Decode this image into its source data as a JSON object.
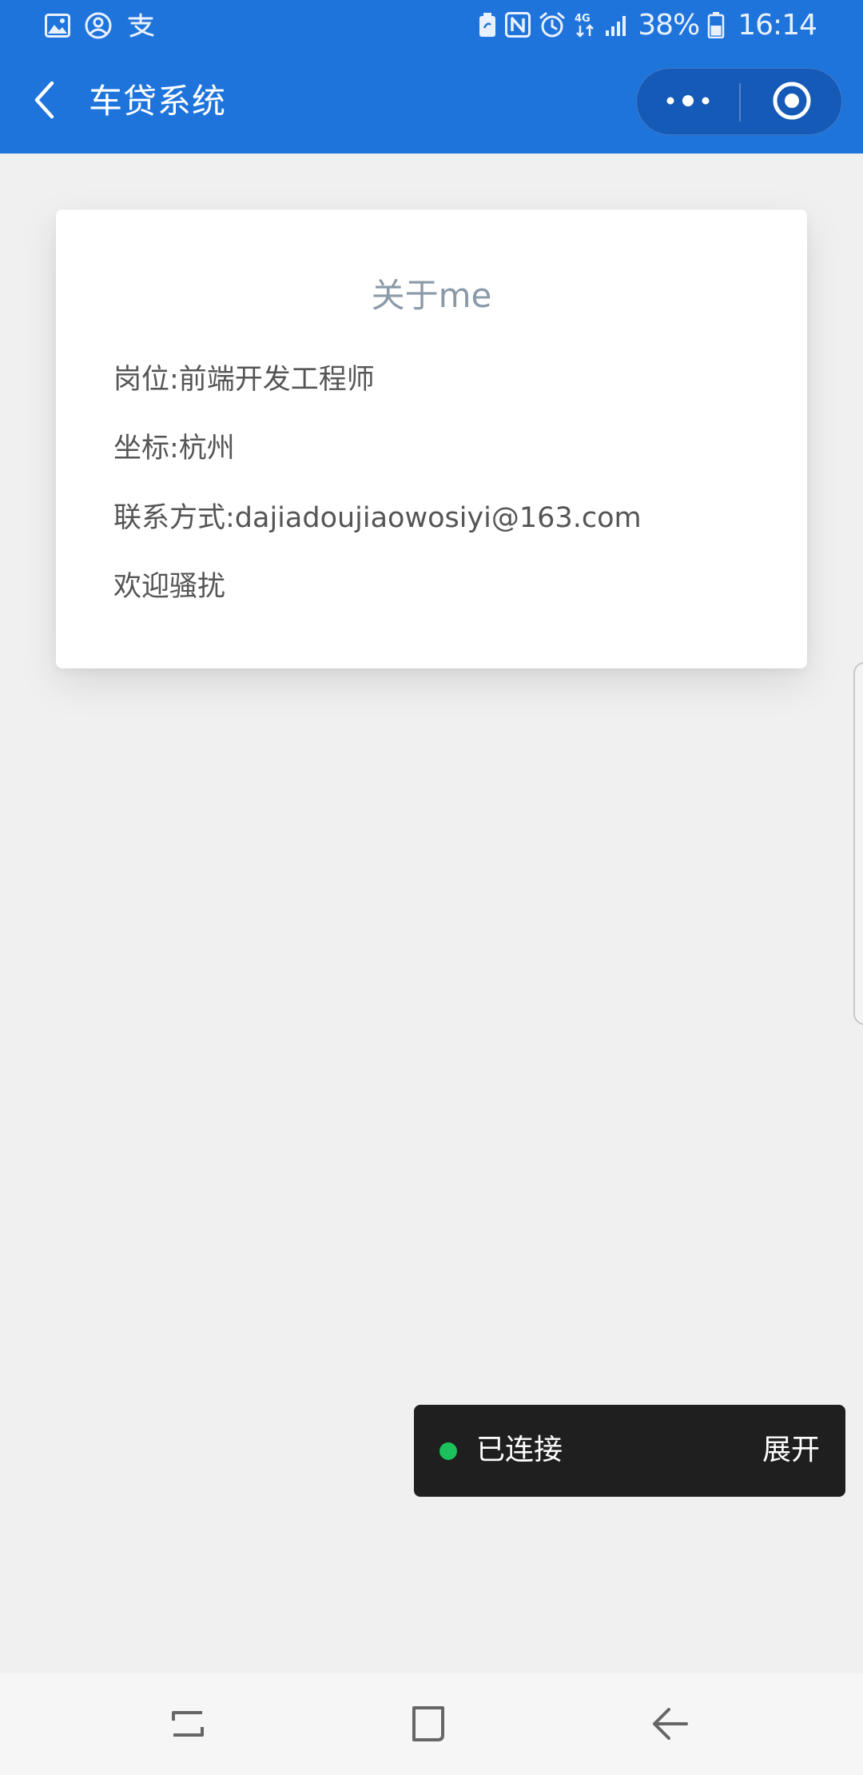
{
  "status_bar": {
    "left_icons": [
      "gallery-icon",
      "account-icon",
      "alipay-icon"
    ],
    "right_icons": [
      "battery-saver-icon",
      "nfc-icon",
      "alarm-icon",
      "4g-icon",
      "signal-icon"
    ],
    "battery_percent": "38%",
    "time": "16:14"
  },
  "nav": {
    "title": "车贷系统",
    "back_icon": "chevron-left-icon",
    "more_icon": "more-dots-icon",
    "close_icon": "target-circle-icon"
  },
  "card": {
    "title": "关于me",
    "lines": [
      "岗位:前端开发工程师",
      "坐标:杭州",
      "联系方式:dajiadoujiaowosiyi@163.com",
      "欢迎骚扰"
    ]
  },
  "toast": {
    "status_text": "已连接",
    "action_text": "展开",
    "status_color": "#1bc15a"
  },
  "bottom_nav": {
    "icons": [
      "recents-icon",
      "home-icon",
      "back-icon"
    ]
  },
  "colors": {
    "primary": "#1f74db",
    "background": "#f0f0f0",
    "toast_background": "#1f1f1f"
  }
}
